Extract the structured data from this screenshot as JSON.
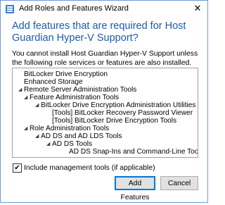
{
  "window": {
    "title": "Add Roles and Features Wizard",
    "close_glyph": "✕"
  },
  "heading": "Add features that are required for Host Guardian Hyper-V Support?",
  "description": "You cannot install Host Guardian Hyper-V Support unless the following role services or features are also installed.",
  "tree": [
    {
      "label": "BitLocker Drive Encryption",
      "expanded": false
    },
    {
      "label": "Enhanced Storage",
      "expanded": false
    },
    {
      "label": "Remote Server Administration Tools",
      "expanded": true
    },
    {
      "label": "Feature Administration Tools",
      "expanded": true
    },
    {
      "label": "BitLocker Drive Encryption Administration Utilities",
      "expanded": true
    },
    {
      "label": "[Tools] BitLocker Recovery Password Viewer",
      "expanded": false
    },
    {
      "label": "[Tools] BitLocker Drive Encryption Tools",
      "expanded": false
    },
    {
      "label": "Role Administration Tools",
      "expanded": true
    },
    {
      "label": "AD DS and AD LDS Tools",
      "expanded": true
    },
    {
      "label": "AD DS Tools",
      "expanded": true
    },
    {
      "label": "AD DS Snap-Ins and Command-Line Tools",
      "expanded": false
    }
  ],
  "include_tools": {
    "label": "Include management tools (if applicable)",
    "checked": true,
    "check_glyph": "✔"
  },
  "buttons": {
    "add_features": "Add Features",
    "cancel": "Cancel"
  },
  "colors": {
    "heading": "#1e5aa8",
    "window_border": "#6f9bd1",
    "button_focus": "#0078d7"
  },
  "icons": {
    "app": "server-manager-icon",
    "expand": "expanded-arrow-icon",
    "close": "close-icon"
  }
}
